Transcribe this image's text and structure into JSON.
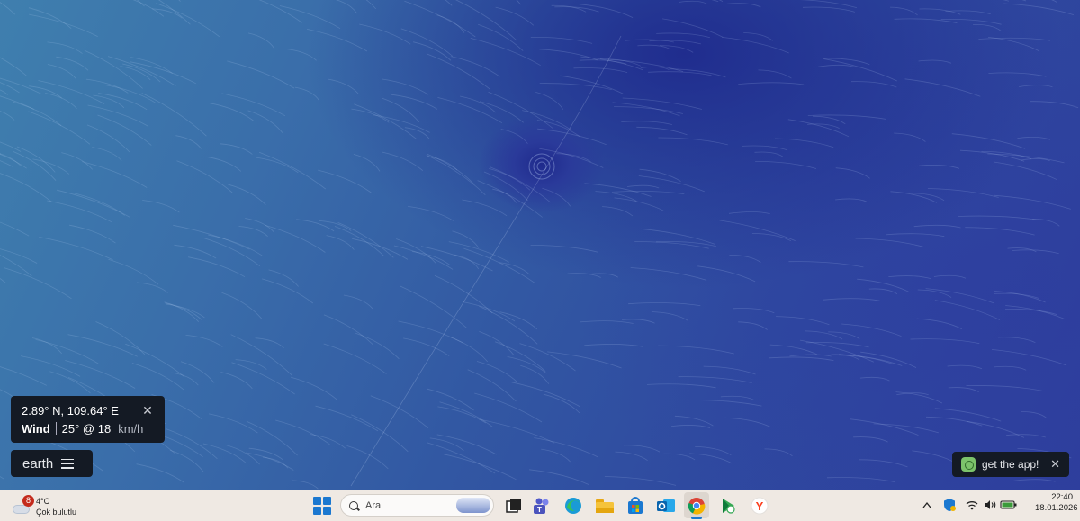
{
  "map": {
    "location": "2.89° N, 109.64° E",
    "overlay_label": "Wind",
    "wind_value": "25° @ 18",
    "wind_unit": "km/h",
    "menu_label": "earth",
    "app_banner": "get the app!",
    "colors": {
      "ocean_light": "#3f7fae",
      "ocean_dark": "#2e3f9c",
      "panel_bg": "#141a24"
    }
  },
  "taskbar": {
    "weather": {
      "badge": "8",
      "temperature": "4°C",
      "condition": "Çok bulutlu"
    },
    "search_placeholder": "Ara",
    "pinned_icons": [
      "task-view-icon",
      "teams-icon",
      "edge-icon",
      "file-explorer-icon",
      "store-icon",
      "outlook-icon",
      "chrome-icon",
      "play-games-icon",
      "yandex-icon"
    ],
    "tray_icons": [
      "chevron-up-icon",
      "security-shield-icon",
      "wifi-icon",
      "speaker-icon",
      "battery-icon"
    ],
    "clock": {
      "time": "22:40",
      "date": "18.01.2026"
    }
  }
}
